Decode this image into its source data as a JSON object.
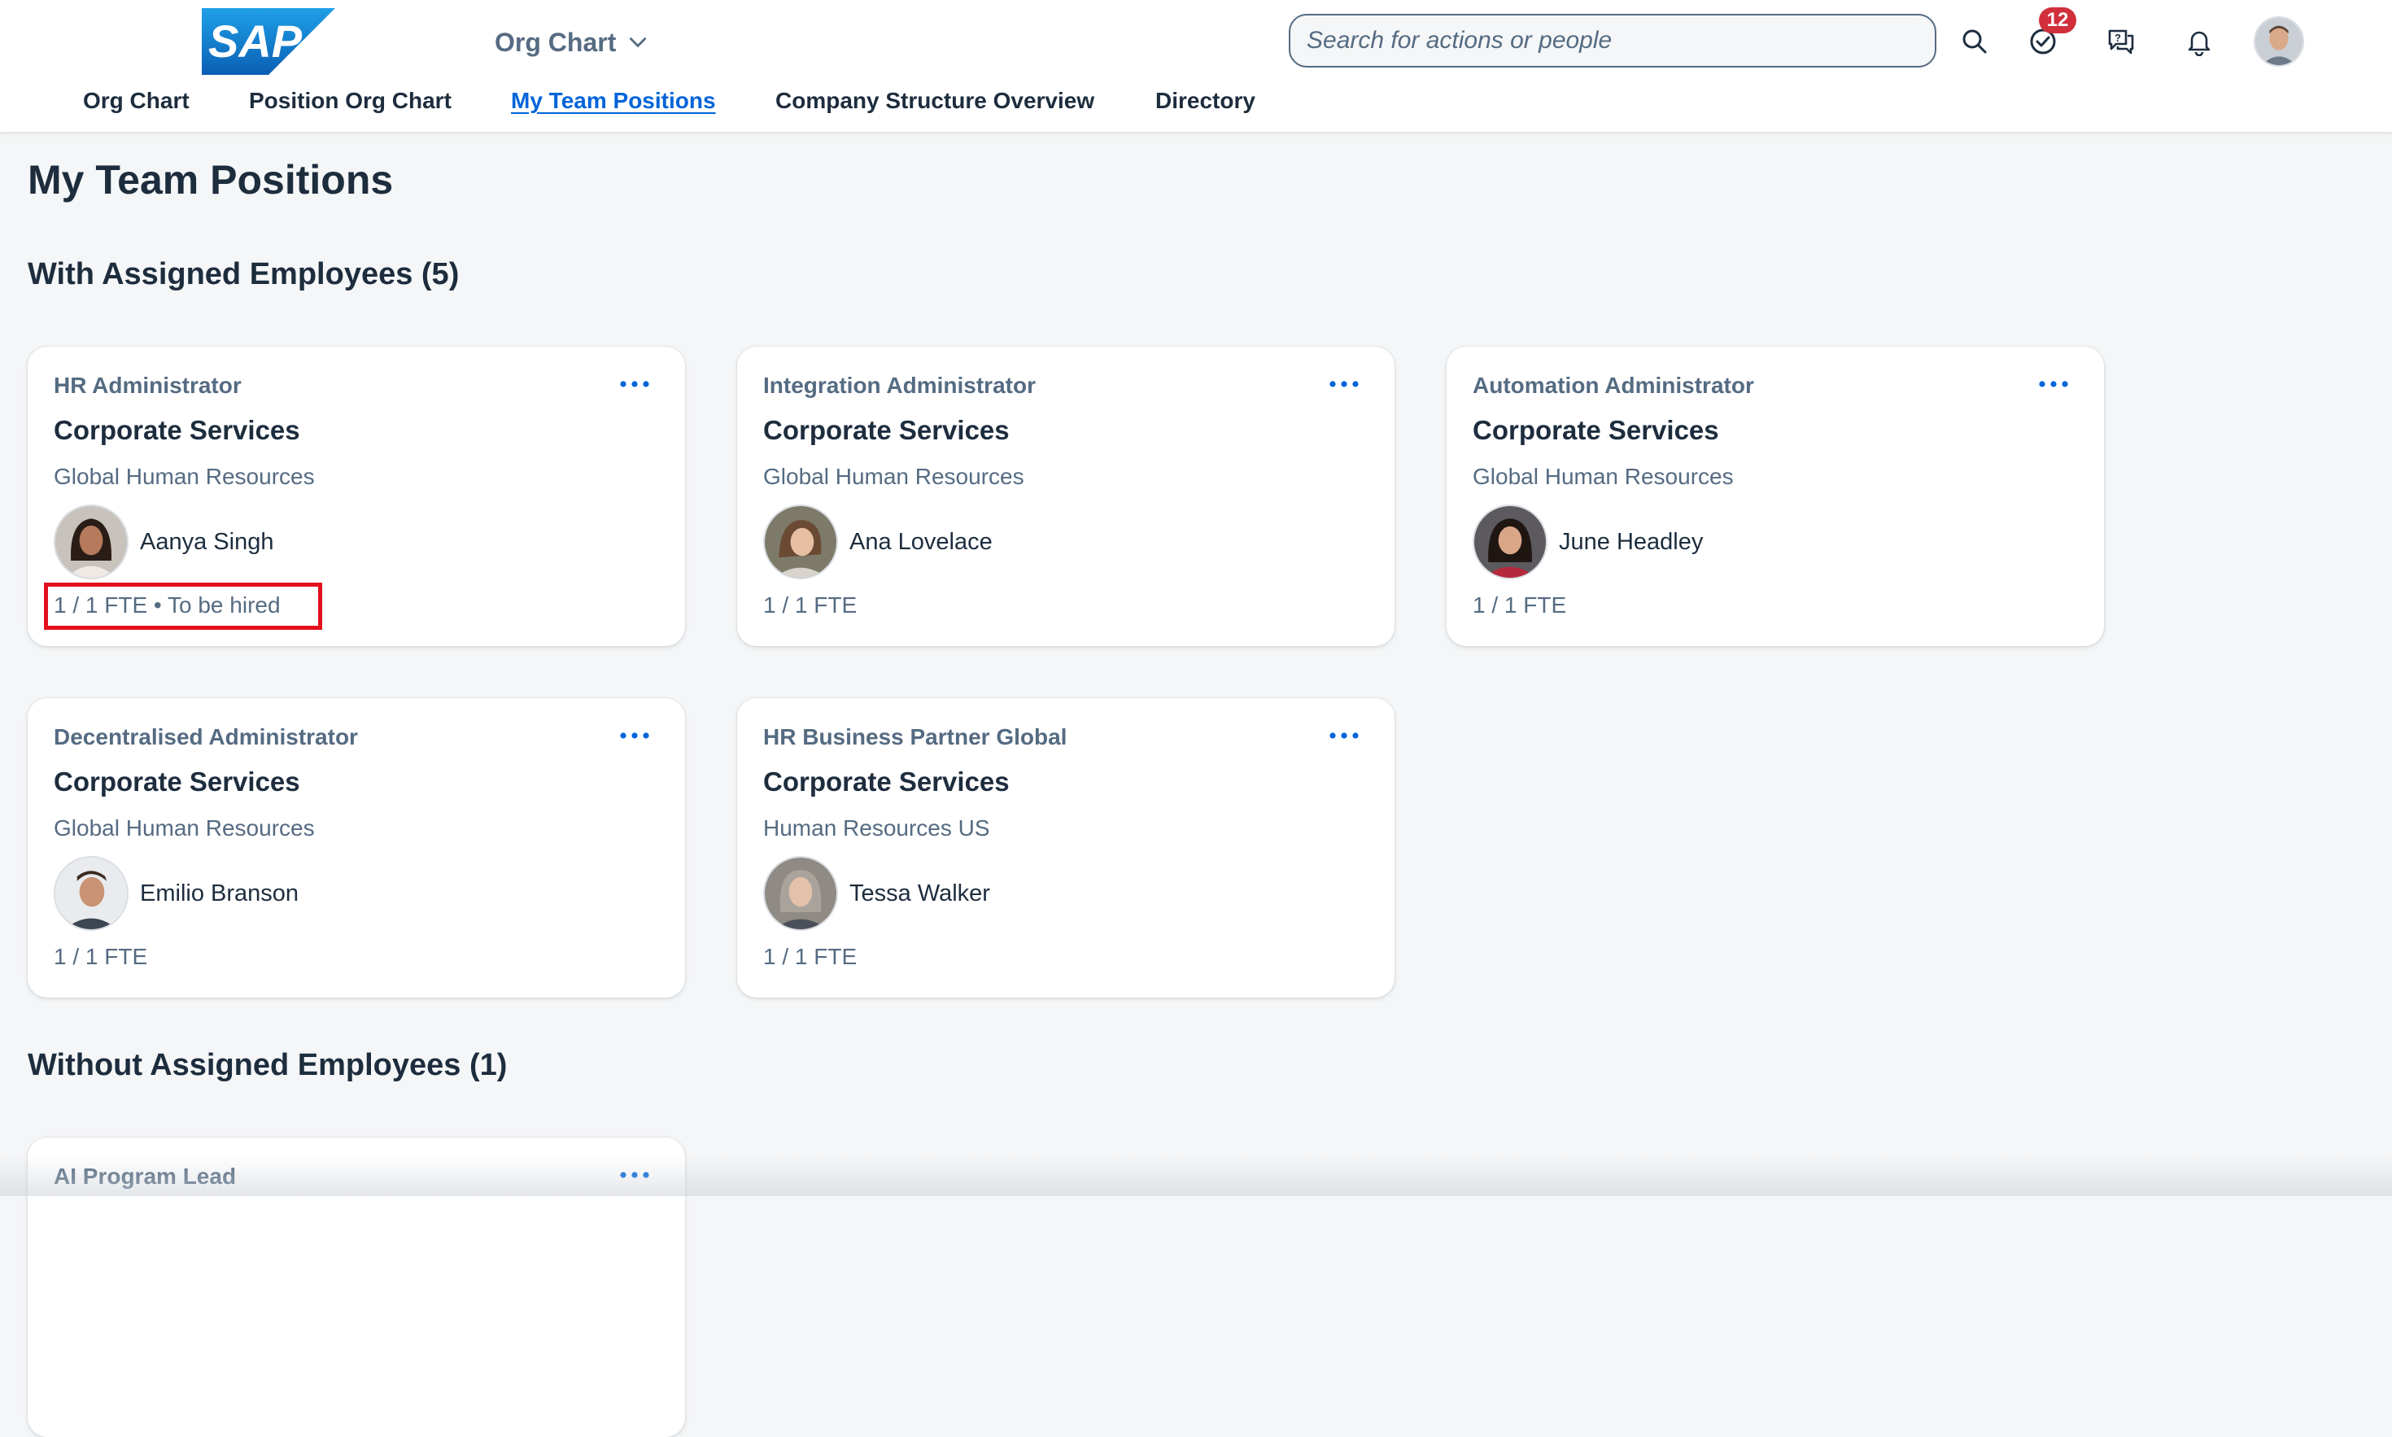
{
  "header": {
    "logo_text": "SAP",
    "app_title": "Org Chart",
    "search": {
      "placeholder": "Search for actions or people",
      "value": ""
    },
    "icons": [
      "search-icon",
      "task-check-icon",
      "chat-help-icon",
      "bell-icon"
    ],
    "tasks_badge": "12"
  },
  "nav": {
    "tabs": [
      {
        "label": "Org Chart",
        "active": false
      },
      {
        "label": "Position Org Chart",
        "active": false
      },
      {
        "label": "My Team Positions",
        "active": true
      },
      {
        "label": "Company Structure Overview",
        "active": false
      },
      {
        "label": "Directory",
        "active": false
      }
    ]
  },
  "page": {
    "title": "My Team Positions"
  },
  "sections": [
    {
      "title": "With Assigned Employees (5)",
      "cards": [
        {
          "role": "HR Administrator",
          "org": "Corporate Services",
          "dept": "Global Human Resources",
          "employee": "Aanya Singh",
          "fte": "1 / 1 FTE • To be hired",
          "highlighted": true
        },
        {
          "role": "Integration Administrator",
          "org": "Corporate Services",
          "dept": "Global Human Resources",
          "employee": "Ana Lovelace",
          "fte": "1 / 1 FTE"
        },
        {
          "role": "Automation Administrator",
          "org": "Corporate Services",
          "dept": "Global Human Resources",
          "employee": "June Headley",
          "fte": "1 / 1 FTE"
        },
        {
          "role": "Decentralised Administrator",
          "org": "Corporate Services",
          "dept": "Global Human Resources",
          "employee": "Emilio Branson",
          "fte": "1 / 1 FTE"
        },
        {
          "role": "HR Business Partner Global",
          "org": "Corporate Services",
          "dept": "Human Resources US",
          "employee": "Tessa Walker",
          "fte": "1 / 1 FTE"
        }
      ]
    },
    {
      "title": "Without Assigned Employees (1)",
      "cards": [
        {
          "role": "AI Program Lead"
        }
      ]
    }
  ],
  "colors": {
    "brand_blue": "#0a6ed1",
    "link_blue": "#0064d9",
    "badge_red": "#d12f3c",
    "highlight_red": "#e3101e"
  }
}
